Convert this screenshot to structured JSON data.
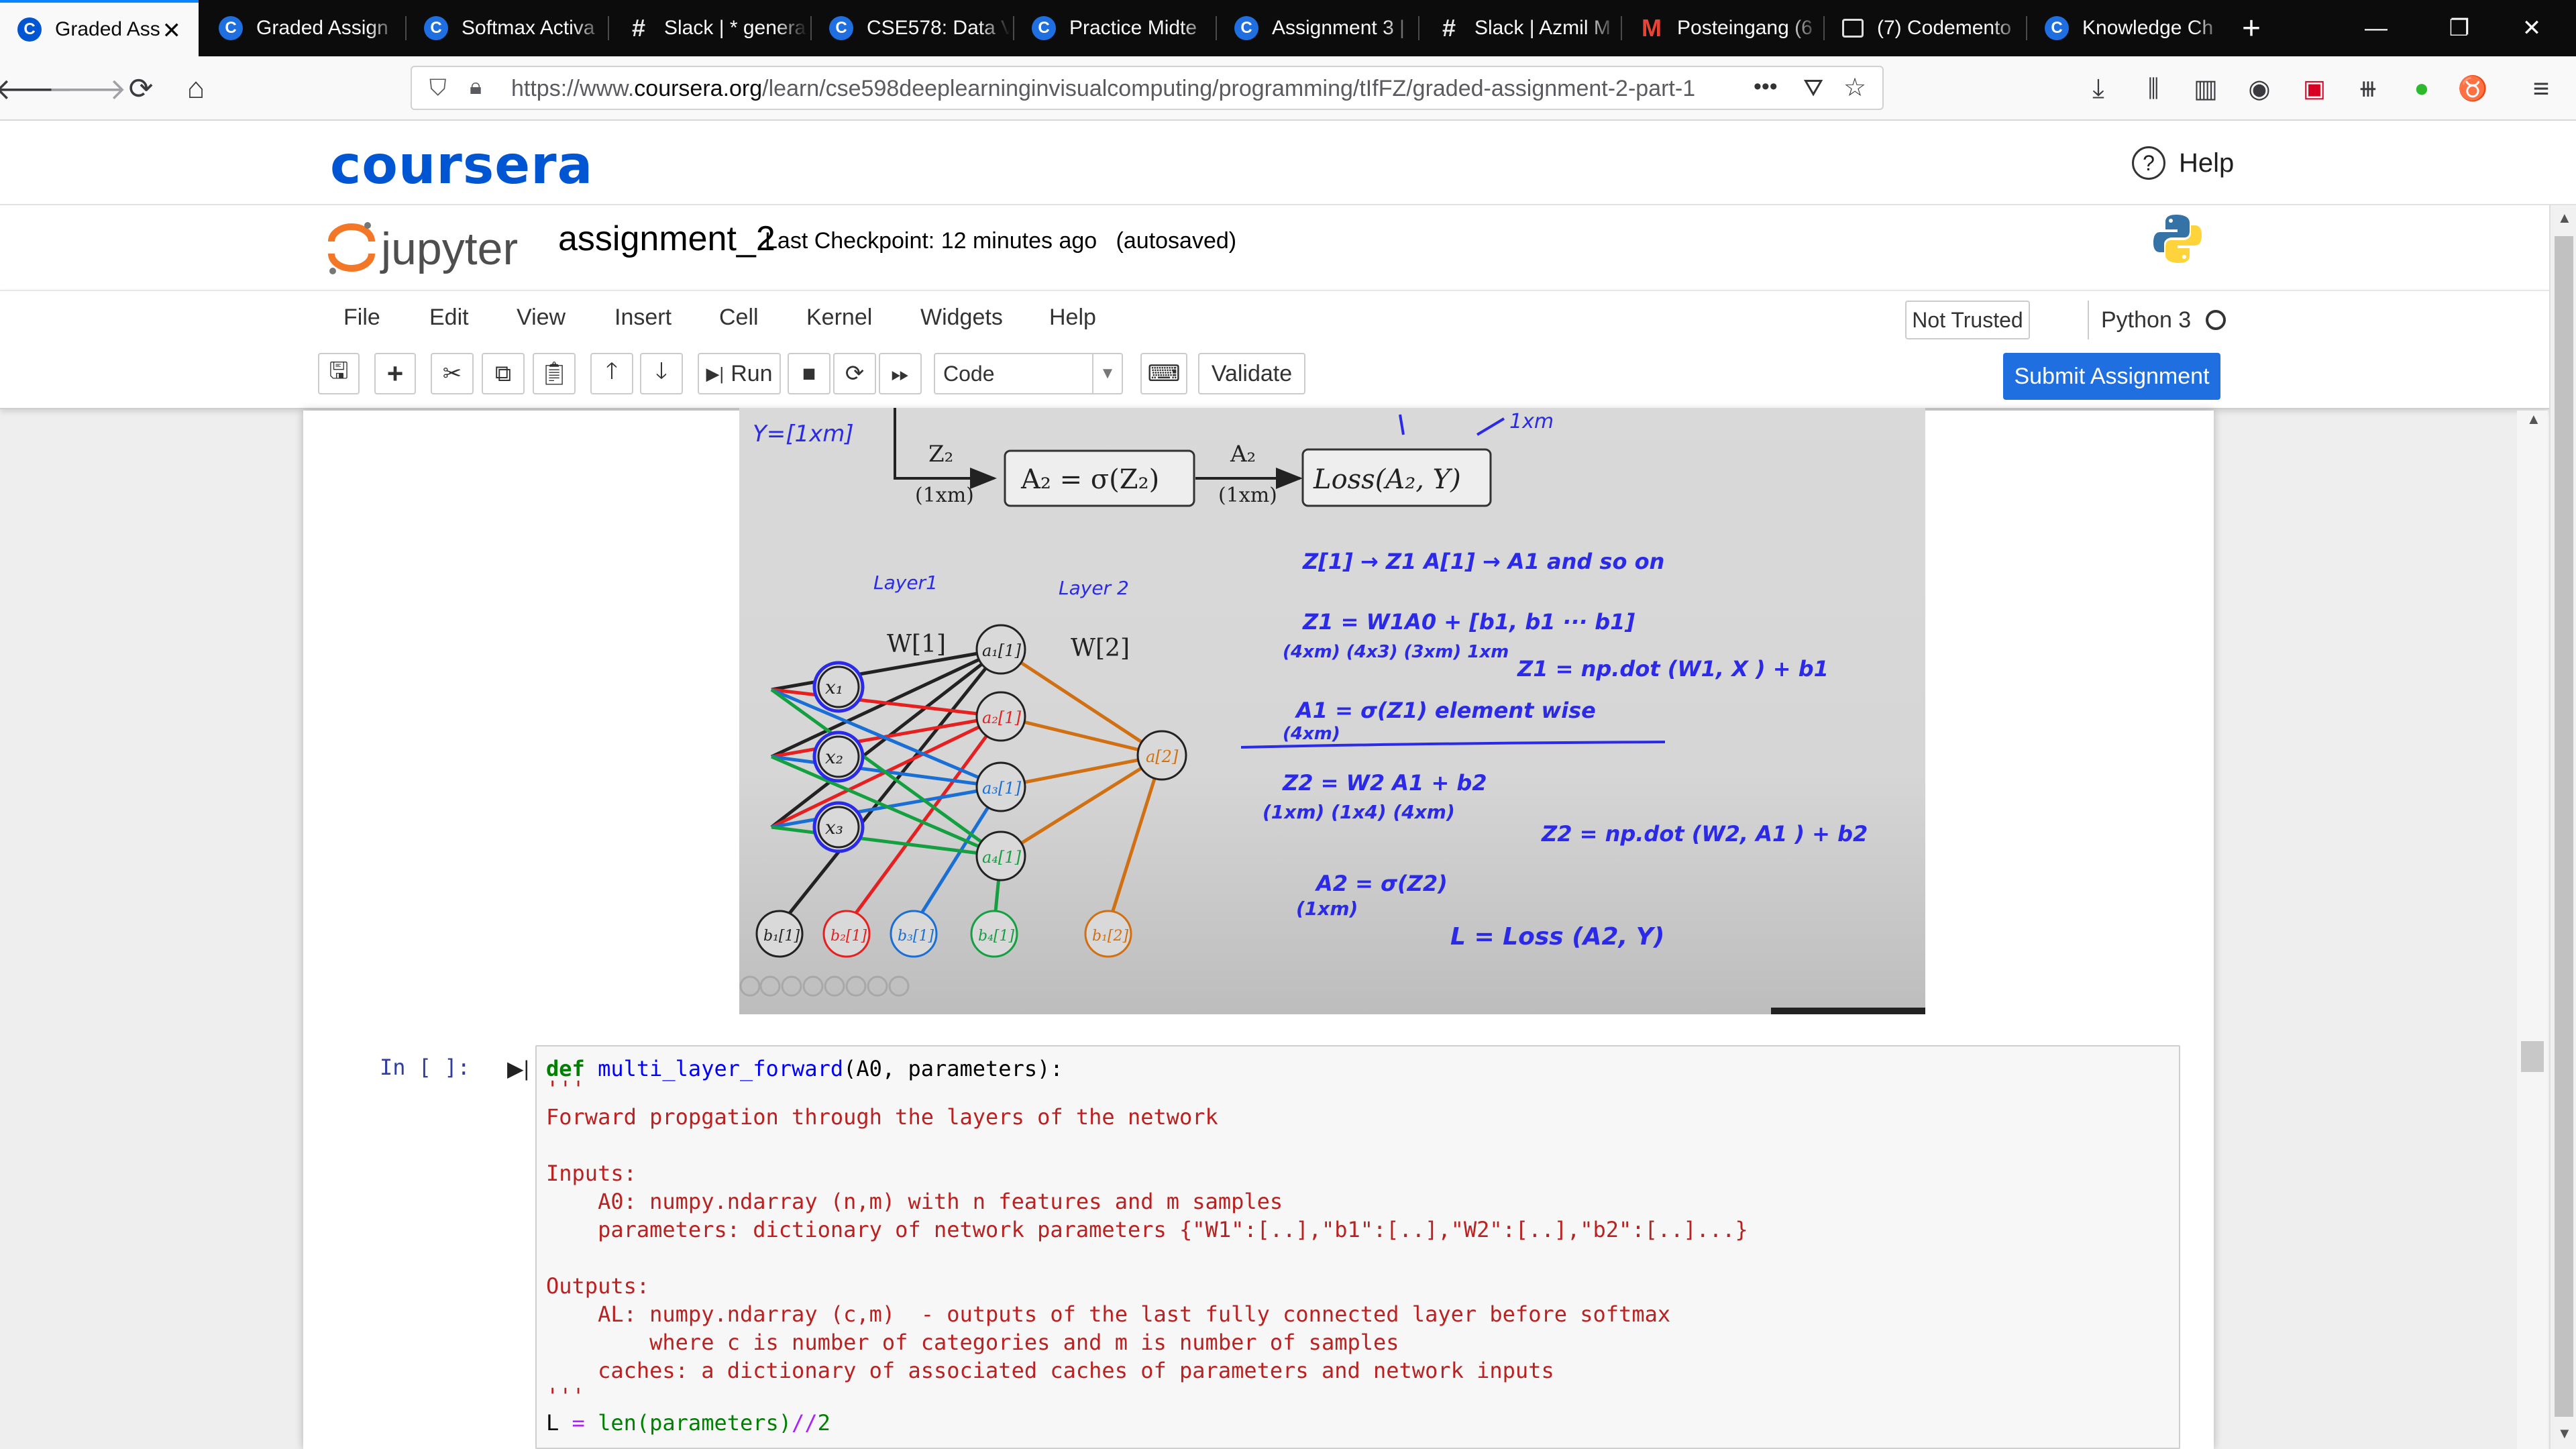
{
  "browser": {
    "tabs": [
      {
        "title": "Graded Ass",
        "icon": "coursera-icon",
        "active": true
      },
      {
        "title": "Graded Assign",
        "icon": "coursera-icon"
      },
      {
        "title": "Softmax Activa",
        "icon": "coursera-icon"
      },
      {
        "title": "Slack | * genera",
        "icon": "slack-icon"
      },
      {
        "title": "CSE578: Data V",
        "icon": "coursera-icon"
      },
      {
        "title": "Practice Midte",
        "icon": "coursera-icon"
      },
      {
        "title": "Assignment 3 |",
        "icon": "coursera-icon"
      },
      {
        "title": "Slack | Azmil M",
        "icon": "slack-icon"
      },
      {
        "title": "Posteingang (6",
        "icon": "gmail-icon"
      },
      {
        "title": "(7) Codemento",
        "icon": "code-icon"
      },
      {
        "title": "Knowledge Ch",
        "icon": "coursera-icon"
      }
    ],
    "url_prefix": "https://www.",
    "url_domain": "coursera.org",
    "url_path": "/learn/cse598deeplearninginvisualcomputing/programming/tIfFZ/graded-assignment-2-part-1",
    "url_more": "•••"
  },
  "coursera": {
    "logo": "coursera",
    "help_label": "Help"
  },
  "jupyter": {
    "logo_text": "jupyter",
    "notebook_name": "assignment_2",
    "checkpoint": "Last Checkpoint: 12 minutes ago",
    "autosave": "(autosaved)",
    "menu": [
      "File",
      "Edit",
      "View",
      "Insert",
      "Cell",
      "Kernel",
      "Widgets",
      "Help"
    ],
    "trust_label": "Not Trusted",
    "kernel_name": "Python 3",
    "toolbar": {
      "run_label": "Run",
      "cell_type": "Code",
      "validate_label": "Validate"
    },
    "submit_label": "Submit Assignment"
  },
  "lecture_notes": {
    "y_label": "Y=[1xm]",
    "z2": "Z₂",
    "z2_dim": "(1xm)",
    "a2_box": "A₂ = σ(Z₂)",
    "a2": "A₂",
    "a2_dim": "(1xm)",
    "loss_box": "Loss(A₂, Y)",
    "top_dim": "1xm",
    "layer1": "Layer1",
    "layer2": "Layer 2",
    "w1": "W[1]",
    "w2": "W[2]",
    "inputs": [
      "x₁",
      "x₂",
      "x₃"
    ],
    "hidden": [
      "a₁[1]",
      "a₂[1]",
      "a₃[1]",
      "a₄[1]"
    ],
    "out": "a[2]",
    "biases1": [
      "b₁[1]",
      "b₂[1]",
      "b₃[1]",
      "b₄[1]"
    ],
    "bias2": "b₁[2]",
    "notes": [
      "Z[1] → Z1      A[1] → A1    and so on",
      "Z1 = W1A0 + [b1, b1 ··· b1]",
      "(4xm)  (4x3) (3xm)        1xm",
      "Z1 = np.dot (W1, X ) + b1",
      "A1 = σ(Z1)     element wise",
      "(4xm)",
      "Z2 = W2 A1 + b2",
      "(1xm)  (1x4) (4xm)",
      "Z2 = np.dot (W2, A1 ) + b2",
      "A2 = σ(Z2)",
      "(1xm)",
      "L = Loss (A2, Y)"
    ]
  },
  "cell": {
    "prompt": "In [ ]:",
    "def_kw": "def",
    "func_name": "multi_layer_forward",
    "signature": "(A0, parameters):",
    "doc_lines": [
      "'''",
      "Forward propgation through the layers of the network",
      "",
      "Inputs:",
      "    A0: numpy.ndarray (n,m) with n features and m samples",
      "    parameters: dictionary of network parameters {\"W1\":[..],\"b1\":[..],\"W2\":[..],\"b2\":[..]...}",
      "",
      "Outputs:",
      "    AL: numpy.ndarray (c,m)  - outputs of the last fully connected layer before softmax",
      "        where c is number of categories and m is number of samples",
      "    caches: a dictionary of associated caches of parameters and network inputs",
      "'''"
    ],
    "last_line": {
      "var": "L",
      "op": "=",
      "call": "len(parameters)",
      "floordiv": "//",
      "num": "2"
    }
  }
}
